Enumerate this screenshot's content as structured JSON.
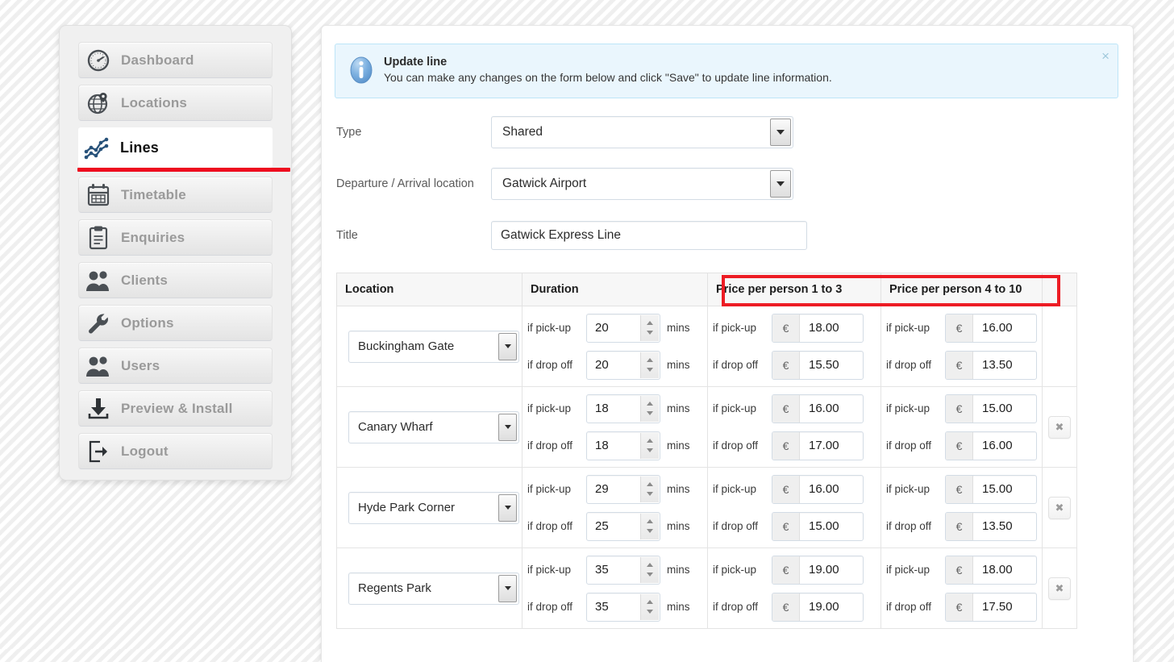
{
  "sidebar": {
    "items": [
      {
        "label": "Dashboard",
        "icon": "gauge-icon",
        "active": false
      },
      {
        "label": "Locations",
        "icon": "globe-pin-icon",
        "active": false
      },
      {
        "label": "Lines",
        "icon": "chart-line-icon",
        "active": true
      },
      {
        "label": "Timetable",
        "icon": "calendar-icon",
        "active": false
      },
      {
        "label": "Enquiries",
        "icon": "clipboard-icon",
        "active": false
      },
      {
        "label": "Clients",
        "icon": "users-icon",
        "active": false
      },
      {
        "label": "Options",
        "icon": "wrench-icon",
        "active": false
      },
      {
        "label": "Users",
        "icon": "users-icon",
        "active": false
      },
      {
        "label": "Preview & Install",
        "icon": "download-icon",
        "active": false
      },
      {
        "label": "Logout",
        "icon": "logout-icon",
        "active": false
      }
    ]
  },
  "alert": {
    "icon": "info-icon",
    "title": "Update line",
    "text": "You can make any changes on the form below and click \"Save\" to update line information.",
    "close_label": "×"
  },
  "form": {
    "type": {
      "label": "Type",
      "value": "Shared"
    },
    "location": {
      "label": "Departure / Arrival location",
      "value": "Gatwick Airport"
    },
    "title": {
      "label": "Title",
      "value": "Gatwick Express Line",
      "placeholder": ""
    }
  },
  "table": {
    "headers": {
      "location": "Location",
      "duration": "Duration",
      "price_1_3": "Price per person 1 to 3",
      "price_4_10": "Price per person 4 to 10",
      "actions": ""
    },
    "labels": {
      "pickup": "if pick-up",
      "dropoff": "if drop off",
      "unit": "mins",
      "currency": "€",
      "delete": "✖"
    },
    "rows": [
      {
        "location": "Buckingham Gate",
        "duration_pickup": "20",
        "duration_dropoff": "20",
        "price13_pickup": "18.00",
        "price13_dropoff": "15.50",
        "price410_pickup": "16.00",
        "price410_dropoff": "13.50",
        "deletable": false
      },
      {
        "location": "Canary Wharf",
        "duration_pickup": "18",
        "duration_dropoff": "18",
        "price13_pickup": "16.00",
        "price13_dropoff": "17.00",
        "price410_pickup": "15.00",
        "price410_dropoff": "16.00",
        "deletable": true
      },
      {
        "location": "Hyde Park Corner",
        "duration_pickup": "29",
        "duration_dropoff": "25",
        "price13_pickup": "16.00",
        "price13_dropoff": "15.00",
        "price410_pickup": "15.00",
        "price410_dropoff": "13.50",
        "deletable": true
      },
      {
        "location": "Regents Park",
        "duration_pickup": "35",
        "duration_dropoff": "35",
        "price13_pickup": "19.00",
        "price13_dropoff": "19.00",
        "price410_pickup": "18.00",
        "price410_dropoff": "17.50",
        "deletable": true
      }
    ]
  },
  "annotation": {
    "highlight_color": "#ed1c24"
  }
}
